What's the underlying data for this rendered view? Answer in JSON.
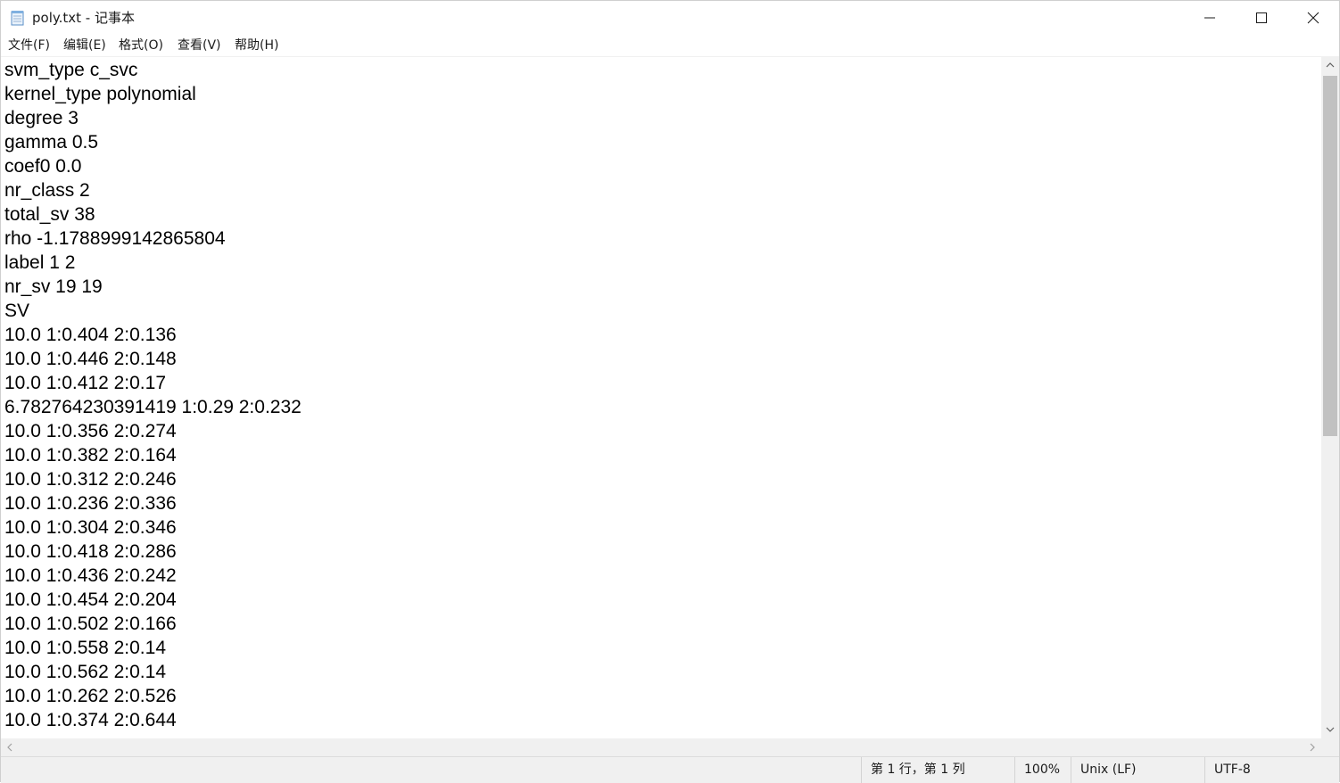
{
  "window": {
    "title": "poly.txt - 记事本",
    "controls": {
      "minimize_icon": "minimize-icon",
      "maximize_icon": "maximize-icon",
      "close_icon": "close-icon"
    }
  },
  "menu": {
    "items": [
      "文件(F)",
      "编辑(E)",
      "格式(O)",
      "查看(V)",
      "帮助(H)"
    ]
  },
  "editor": {
    "lines": [
      "svm_type c_svc",
      "kernel_type polynomial",
      "degree 3",
      "gamma 0.5",
      "coef0 0.0",
      "nr_class 2",
      "total_sv 38",
      "rho -1.1788999142865804",
      "label 1 2",
      "nr_sv 19 19",
      "SV",
      "10.0 1:0.404 2:0.136",
      "10.0 1:0.446 2:0.148",
      "10.0 1:0.412 2:0.17",
      "6.782764230391419 1:0.29 2:0.232",
      "10.0 1:0.356 2:0.274",
      "10.0 1:0.382 2:0.164",
      "10.0 1:0.312 2:0.246",
      "10.0 1:0.236 2:0.336",
      "10.0 1:0.304 2:0.346",
      "10.0 1:0.418 2:0.286",
      "10.0 1:0.436 2:0.242",
      "10.0 1:0.454 2:0.204",
      "10.0 1:0.502 2:0.166",
      "10.0 1:0.558 2:0.14",
      "10.0 1:0.562 2:0.14",
      "10.0 1:0.262 2:0.526",
      "10.0 1:0.374 2:0.644"
    ]
  },
  "status": {
    "position": "第 1 行，第 1 列",
    "zoom": "100%",
    "line_ending": "Unix (LF)",
    "encoding": "UTF-8"
  },
  "colors": {
    "background": "#ffffff",
    "chrome": "#f0f0f0",
    "scroll_thumb": "#c1c1c1",
    "text": "#000000"
  }
}
